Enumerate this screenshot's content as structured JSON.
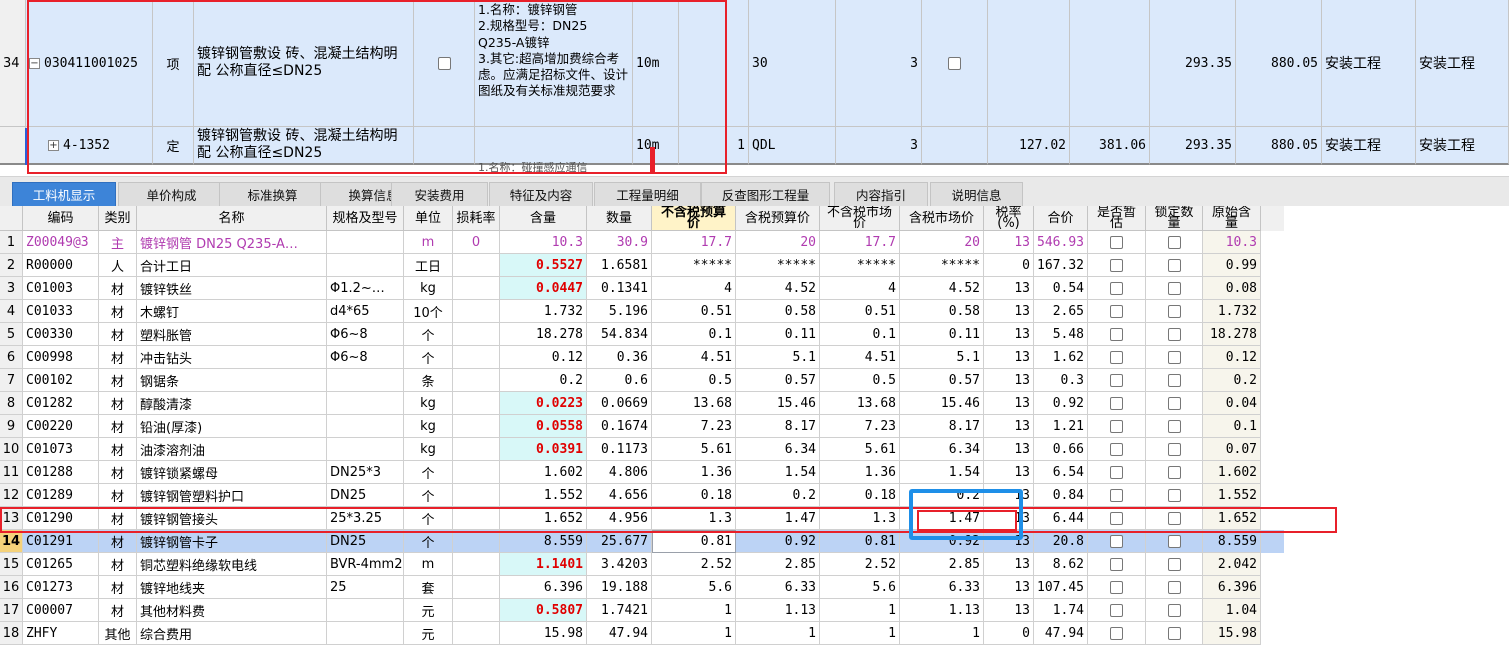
{
  "top_grid": {
    "rows": [
      {
        "row_no": "34",
        "tree": "−",
        "code": "030411001025",
        "type": "项",
        "name": "镀锌钢管敷设 砖、混凝土结构明配 公称直径≤DN25",
        "desc": "1.名称：镀锌钢管\n2.规格型号：DN25 Q235-A镀锌\n3.其它:超高增加费综合考虑。应满足招标文件、设计图纸及有关标准规范要求",
        "unit": "10m",
        "qty_expr": "",
        "qty_label": "30",
        "qty": "3",
        "price_a": "",
        "price_b": "",
        "unit_price": "293.35",
        "total": "880.05",
        "major1": "安装工程",
        "major2": "安装工程"
      },
      {
        "row_no": "",
        "tree": "+",
        "code": "4-1352",
        "type": "定",
        "name": "镀锌钢管敷设 砖、混凝土结构明配 公称直径≤DN25",
        "desc": "",
        "unit": "10m",
        "qty_expr": "1",
        "qty_label": "QDL",
        "qty": "3",
        "price_a": "127.02",
        "price_b": "381.06",
        "unit_price": "293.35",
        "total": "880.05",
        "major1": "安装工程",
        "major2": "安装工程"
      }
    ],
    "partial_desc": "1.名称：碰撞感应通信"
  },
  "tabs": [
    {
      "label": "工料机显示",
      "active": true
    },
    {
      "label": "单价构成",
      "active": false
    },
    {
      "label": "标准换算",
      "active": false
    },
    {
      "label": "换算信息",
      "active": false
    },
    {
      "label": "安装费用",
      "active": false
    },
    {
      "label": "特征及内容",
      "active": false
    },
    {
      "label": "工程量明细",
      "active": false
    },
    {
      "label": "反查图形工程量",
      "active": false
    },
    {
      "label": "内容指引",
      "active": false
    },
    {
      "label": "说明信息",
      "active": false
    }
  ],
  "bottom_grid": {
    "headers": [
      "",
      "编码",
      "类别",
      "名称",
      "规格及型号",
      "单位",
      "损耗率",
      "含量",
      "数量",
      "不含税预算价",
      "含税预算价",
      "不含税市场价",
      "含税市场价",
      "税率(%)",
      "合价",
      "是否暂估",
      "锁定数量",
      "原始含量"
    ],
    "rows": [
      [
        "1",
        "Z00049@3",
        "主",
        "镀锌钢管 DN25 Q235-A…",
        "",
        "m",
        "0",
        "10.3",
        "30.9",
        "17.7",
        "20",
        "17.7",
        "20",
        "13",
        "546.93",
        "",
        "",
        "10.3"
      ],
      [
        "2",
        "R00000",
        "人",
        "合计工日",
        "",
        "工日",
        "",
        "0.5527",
        "1.6581",
        "*****",
        "*****",
        "*****",
        "*****",
        "0",
        "167.32",
        "",
        "",
        "0.99"
      ],
      [
        "3",
        "C01003",
        "材",
        "镀锌铁丝",
        "Φ1.2~…",
        "kg",
        "",
        "0.0447",
        "0.1341",
        "4",
        "4.52",
        "4",
        "4.52",
        "13",
        "0.54",
        "",
        "",
        "0.08"
      ],
      [
        "4",
        "C01033",
        "材",
        "木螺钉",
        "d4*65",
        "10个",
        "",
        "1.732",
        "5.196",
        "0.51",
        "0.58",
        "0.51",
        "0.58",
        "13",
        "2.65",
        "",
        "",
        "1.732"
      ],
      [
        "5",
        "C00330",
        "材",
        "塑料胀管",
        "Φ6~8",
        "个",
        "",
        "18.278",
        "54.834",
        "0.1",
        "0.11",
        "0.1",
        "0.11",
        "13",
        "5.48",
        "",
        "",
        "18.278"
      ],
      [
        "6",
        "C00998",
        "材",
        "冲击钻头",
        "Φ6~8",
        "个",
        "",
        "0.12",
        "0.36",
        "4.51",
        "5.1",
        "4.51",
        "5.1",
        "13",
        "1.62",
        "",
        "",
        "0.12"
      ],
      [
        "7",
        "C00102",
        "材",
        "钢锯条",
        "",
        "条",
        "",
        "0.2",
        "0.6",
        "0.5",
        "0.57",
        "0.5",
        "0.57",
        "13",
        "0.3",
        "",
        "",
        "0.2"
      ],
      [
        "8",
        "C01282",
        "材",
        "醇酸清漆",
        "",
        "kg",
        "",
        "0.0223",
        "0.0669",
        "13.68",
        "15.46",
        "13.68",
        "15.46",
        "13",
        "0.92",
        "",
        "",
        "0.04"
      ],
      [
        "9",
        "C00220",
        "材",
        "铅油(厚漆)",
        "",
        "kg",
        "",
        "0.0558",
        "0.1674",
        "7.23",
        "8.17",
        "7.23",
        "8.17",
        "13",
        "1.21",
        "",
        "",
        "0.1"
      ],
      [
        "10",
        "C01073",
        "材",
        "油漆溶剂油",
        "",
        "kg",
        "",
        "0.0391",
        "0.1173",
        "5.61",
        "6.34",
        "5.61",
        "6.34",
        "13",
        "0.66",
        "",
        "",
        "0.07"
      ],
      [
        "11",
        "C01288",
        "材",
        "镀锌锁紧螺母",
        "DN25*3",
        "个",
        "",
        "1.602",
        "4.806",
        "1.36",
        "1.54",
        "1.36",
        "1.54",
        "13",
        "6.54",
        "",
        "",
        "1.602"
      ],
      [
        "12",
        "C01289",
        "材",
        "镀锌钢管塑料护口",
        "DN25",
        "个",
        "",
        "1.552",
        "4.656",
        "0.18",
        "0.2",
        "0.18",
        "0.2",
        "13",
        "0.84",
        "",
        "",
        "1.552"
      ],
      [
        "13",
        "C01290",
        "材",
        "镀锌钢管接头",
        "25*3.25",
        "个",
        "",
        "1.652",
        "4.956",
        "1.3",
        "1.47",
        "1.3",
        "1.47",
        "13",
        "6.44",
        "",
        "",
        "1.652"
      ],
      [
        "14",
        "C01291",
        "材",
        "镀锌钢管卡子",
        "DN25",
        "个",
        "",
        "8.559",
        "25.677",
        "0.81",
        "0.92",
        "0.81",
        "0.92",
        "13",
        "20.8",
        "",
        "",
        "8.559"
      ],
      [
        "15",
        "C01265",
        "材",
        "铜芯塑料绝缘软电线",
        "BVR-4mm2",
        "m",
        "",
        "1.1401",
        "3.4203",
        "2.52",
        "2.85",
        "2.52",
        "2.85",
        "13",
        "8.62",
        "",
        "",
        "2.042"
      ],
      [
        "16",
        "C01273",
        "材",
        "镀锌地线夹",
        "25",
        "套",
        "",
        "6.396",
        "19.188",
        "5.6",
        "6.33",
        "5.6",
        "6.33",
        "13",
        "107.45",
        "",
        "",
        "6.396"
      ],
      [
        "17",
        "C00007",
        "材",
        "其他材料费",
        "",
        "元",
        "",
        "0.5807",
        "1.7421",
        "1",
        "1.13",
        "1",
        "1.13",
        "13",
        "1.74",
        "",
        "",
        "1.04"
      ],
      [
        "18",
        "ZHFY",
        "其他",
        "综合费用",
        "",
        "元",
        "",
        "15.98",
        "47.94",
        "1",
        "1",
        "1",
        "1",
        "0",
        "47.94",
        "",
        "",
        "15.98"
      ]
    ],
    "highlight_content_rows": [
      1,
      2,
      7,
      8,
      9,
      14,
      16
    ],
    "selected_row": 13,
    "colors": {
      "selected": "#bcd3f5",
      "content_highlight": "#d8f8f8",
      "annotation_red": "#e8202a",
      "annotation_blue": "#1e8fe8"
    }
  }
}
